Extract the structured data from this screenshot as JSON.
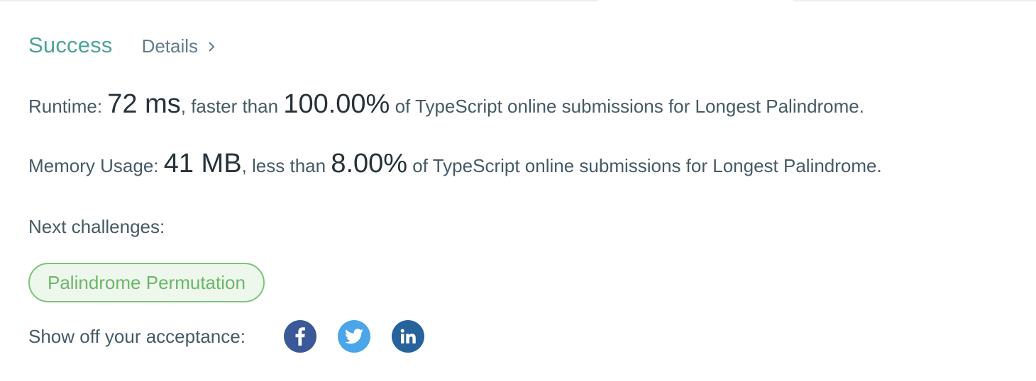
{
  "result": {
    "status": "Success",
    "details_label": "Details"
  },
  "runtime": {
    "label": "Runtime:",
    "value": "72 ms",
    "comparison": ", faster than",
    "percent": "100.00%",
    "suffix": "of TypeScript online submissions for Longest Palindrome."
  },
  "memory": {
    "label": "Memory Usage:",
    "value": "41 MB",
    "comparison": ", less than",
    "percent": "8.00%",
    "suffix": "of TypeScript online submissions for Longest Palindrome."
  },
  "next": {
    "label": "Next challenges:",
    "challenges": [
      "Palindrome Permutation"
    ]
  },
  "share": {
    "label": "Show off your acceptance:",
    "networks": [
      {
        "name": "facebook",
        "icon": "facebook-icon",
        "color": "#3b5998"
      },
      {
        "name": "twitter",
        "icon": "twitter-icon",
        "color": "#4aa6e8"
      },
      {
        "name": "linkedin",
        "icon": "linkedin-icon",
        "color": "#27629a"
      }
    ]
  },
  "colors": {
    "success": "#4ba399",
    "challenge_text": "#6db66b",
    "challenge_border": "#7cc47a",
    "challenge_bg": "#eef7ec"
  }
}
